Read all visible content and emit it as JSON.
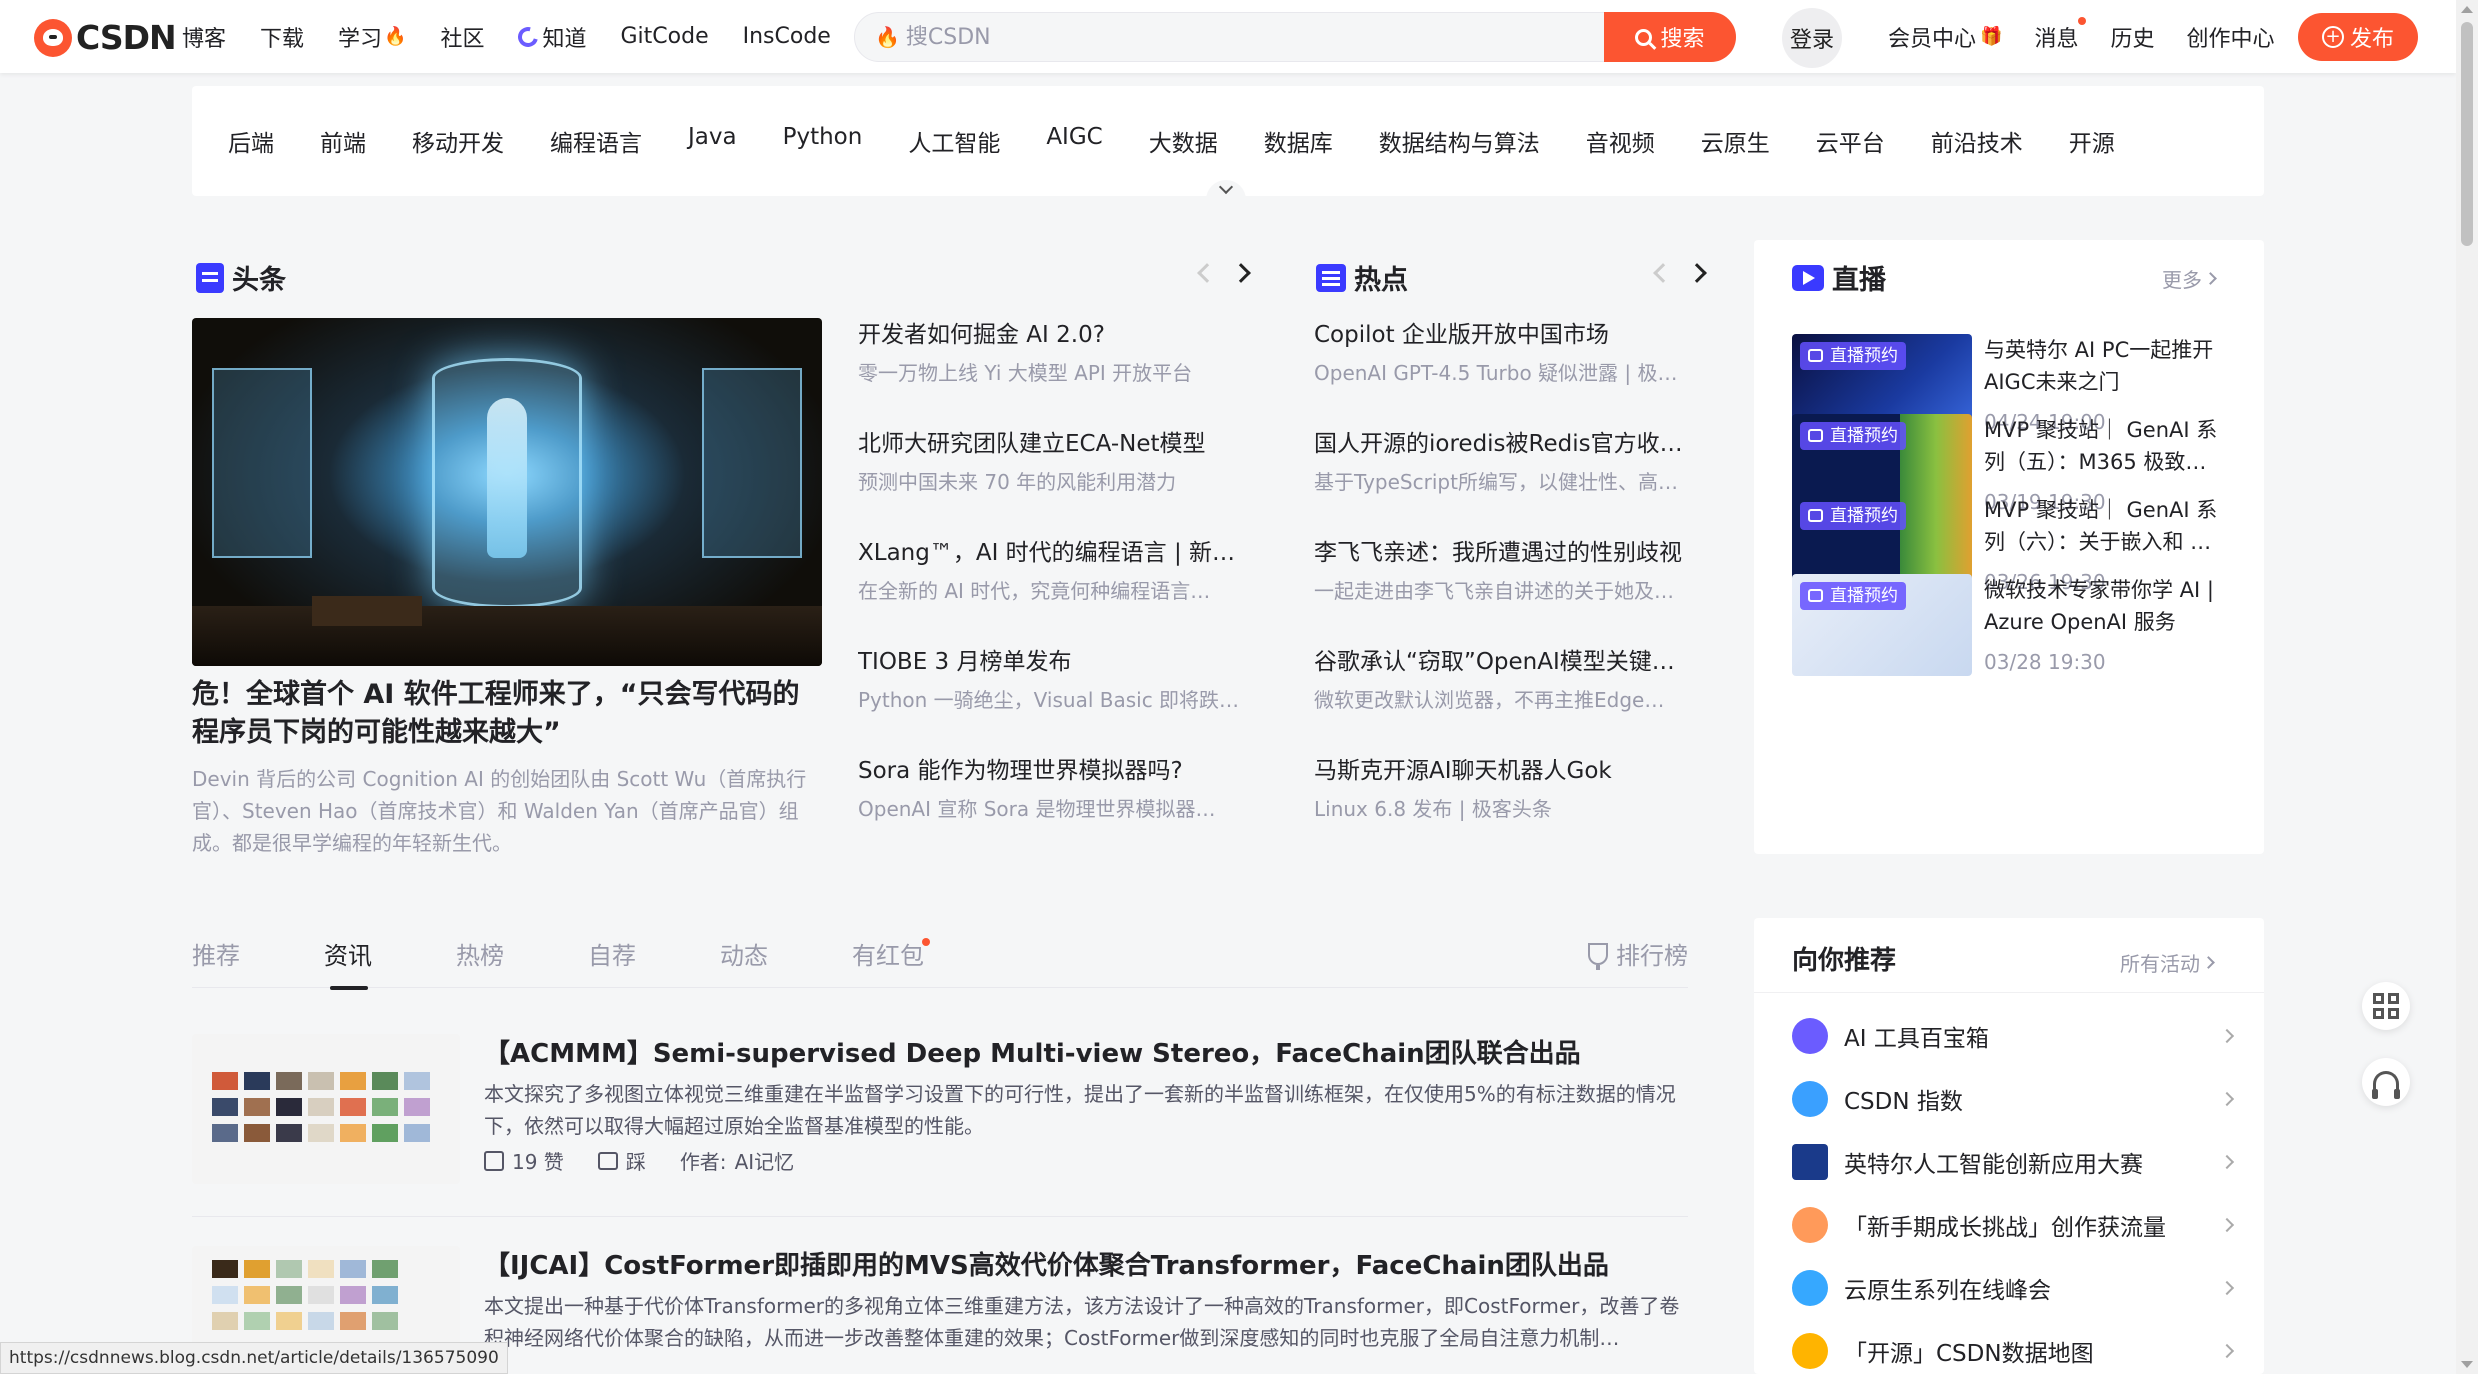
{
  "toolbar": {
    "logo_text": "CSDN",
    "nav": [
      {
        "label": "博客"
      },
      {
        "label": "下载"
      },
      {
        "label": "学习",
        "hot": true
      },
      {
        "label": "社区"
      },
      {
        "label": "知道",
        "icon": "zhidao-icon"
      },
      {
        "label": "GitCode"
      },
      {
        "label": "InsCode"
      }
    ],
    "search_placeholder": "搜CSDN",
    "search_button": "搜索",
    "login": "登录",
    "right_nav": [
      "会员中心",
      "消息",
      "历史",
      "创作中心"
    ],
    "publish": "发布",
    "accent_color": "#fc5531"
  },
  "categories": [
    "后端",
    "前端",
    "移动开发",
    "编程语言",
    "Java",
    "Python",
    "人工智能",
    "AIGC",
    "大数据",
    "数据库",
    "数据结构与算法",
    "音视频",
    "云原生",
    "云平台",
    "前沿技术",
    "开源"
  ],
  "headline": {
    "title": "头条",
    "hero_title": "危！全球首个 AI 软件工程师来了，“只会写代码的程序员下岗的可能性越来越大”",
    "hero_desc": "Devin 背后的公司 Cognition AI 的创始团队由 Scott Wu（首席执行官）、Steven Hao（首席技术官）和 Walden Yan（首席产品官）组成。都是很早学编程的年轻新生代。",
    "items": [
      {
        "title": "开发者如何掘金 AI 2.0?",
        "sub": "零一万物上线 Yi 大模型 API 开放平台"
      },
      {
        "title": "北师大研究团队建立ECA-Net模型",
        "sub": "预测中国未来 70 年的风能利用潜力"
      },
      {
        "title": "XLang™，AI 时代的编程语言 | 新…",
        "sub": "在全新的 AI 时代，究竟何种编程语言…"
      },
      {
        "title": "TIOBE 3 月榜单发布",
        "sub": "Python 一骑绝尘，Visual Basic 即将跌…"
      },
      {
        "title": "Sora 能作为物理世界模拟器吗?",
        "sub": "OpenAI 宣称 Sora 是物理世界模拟器…"
      }
    ]
  },
  "hot": {
    "title": "热点",
    "items": [
      {
        "title": "Copilot 企业版开放中国市场",
        "sub": "OpenAI GPT-4.5 Turbo 疑似泄露 | 极…"
      },
      {
        "title": "国人开源的ioredis被Redis官方收…",
        "sub": "基于TypeScript所编写，以健壮性、高…"
      },
      {
        "title": "李飞飞亲述：我所遭遇过的性别歧视",
        "sub": "一起走进由李飞飞亲自讲述的关于她及…"
      },
      {
        "title": "谷歌承认“窃取”OpenAI模型关键…",
        "sub": "微软更改默认浏览器，不再主推Edge…"
      },
      {
        "title": "马斯克开源AI聊天机器人Gok",
        "sub": "Linux 6.8 发布 | 极客头条"
      }
    ]
  },
  "live": {
    "title": "直播",
    "more": "更多",
    "badge": "直播预约",
    "items": [
      {
        "title": "与英特尔 AI PC一起推开AIGC未来之门",
        "date": "04/24 19:00"
      },
      {
        "title": "MVP 聚技站｜ GenAI 系列（五）：M365 极致…",
        "date": "03/19 19:30"
      },
      {
        "title": "MVP 聚技站｜ GenAI 系列（六）：关于嵌入和 …",
        "date": "03/26 19:30"
      },
      {
        "title": "微软技术专家带你学 AI | Azure OpenAI 服务",
        "date": "03/28 19:30"
      }
    ]
  },
  "feed": {
    "tabs": [
      "推荐",
      "资讯",
      "热榜",
      "自荐",
      "动态",
      "有红包"
    ],
    "active_tab": "资讯",
    "ranking": "排行榜",
    "articles": [
      {
        "title": "【ACMMM】Semi-supervised Deep Multi-view Stereo，FaceChain团队联合出品",
        "desc": "本文探究了多视图立体视觉三维重建在半监督学习设置下的可行性，提出了一套新的半监督训练框架，在仅使用5%的有标注数据的情况下，依然可以取得大幅超过原始全监督基准模型的性能。",
        "likes": "19 赞",
        "comment": "踩",
        "author_label": "作者:",
        "author": "AI记忆"
      },
      {
        "title": "【IJCAI】CostFormer即插即用的MVS高效代价体聚合Transformer，FaceChain团队出品",
        "desc": "本文提出一种基于代价体Transformer的多视角立体三维重建方法，该方法设计了一种高效的Transformer，即CostFormer，改善了卷积神经网络代价体聚合的缺陷，从而进一步改善整体重建的效果；CostFormer做到深度感知的同时也克服了全局自注意力机制…"
      }
    ]
  },
  "recommend": {
    "title": "向你推荐",
    "more": "所有活动",
    "items": [
      {
        "label": "AI 工具百宝箱",
        "color": "#6b5cff"
      },
      {
        "label": "CSDN 指数",
        "color": "#3aa0ff"
      },
      {
        "label": "英特尔人工智能创新应用大赛",
        "color": "#1a3a8a"
      },
      {
        "label": "「新手期成长挑战」创作获流量",
        "color": "#ff9a5a"
      },
      {
        "label": "云原生系列在线峰会",
        "color": "#36a8ff"
      },
      {
        "label": "「开源」CSDN数据地图",
        "color": "#ffb400"
      }
    ]
  },
  "status_url": "https://csdnnews.blog.csdn.net/article/details/136575090"
}
